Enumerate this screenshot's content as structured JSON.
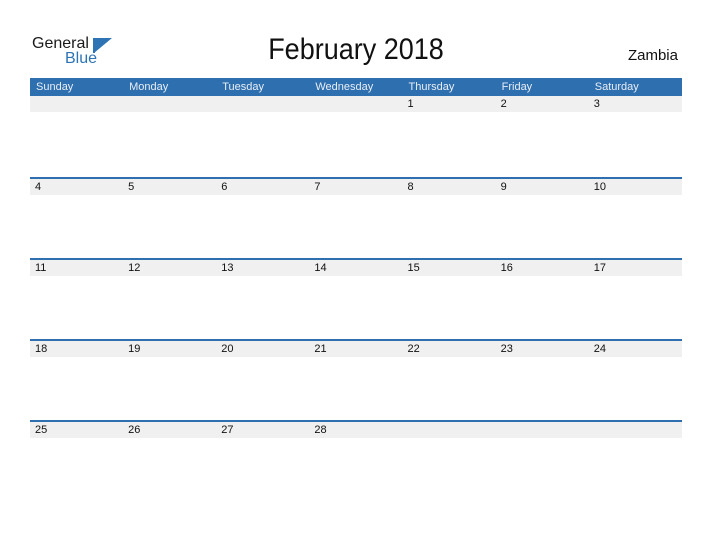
{
  "logo": {
    "line1": "General",
    "line2": "Blue"
  },
  "title": "February 2018",
  "country": "Zambia",
  "weekdays": [
    "Sunday",
    "Monday",
    "Tuesday",
    "Wednesday",
    "Thursday",
    "Friday",
    "Saturday"
  ],
  "weeks": [
    [
      "",
      "",
      "",
      "",
      "1",
      "2",
      "3"
    ],
    [
      "4",
      "5",
      "6",
      "7",
      "8",
      "9",
      "10"
    ],
    [
      "11",
      "12",
      "13",
      "14",
      "15",
      "16",
      "17"
    ],
    [
      "18",
      "19",
      "20",
      "21",
      "22",
      "23",
      "24"
    ],
    [
      "25",
      "26",
      "27",
      "28",
      "",
      "",
      ""
    ]
  ],
  "colors": {
    "accent": "#2e6faf",
    "strip": "#f0f0f0"
  }
}
